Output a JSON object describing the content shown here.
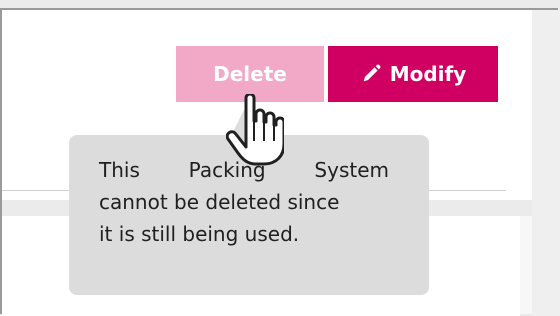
{
  "actions": {
    "delete_label": "Delete",
    "modify_label": "Modify",
    "modify_icon": "pencil-icon",
    "delete_state": "disabled"
  },
  "tooltip": {
    "line1_words": [
      "This",
      "Packing",
      "System"
    ],
    "line2": "cannot be deleted since",
    "line3": "it is still being used."
  },
  "cursor": {
    "icon": "hand-pointer-icon"
  },
  "colors": {
    "primary": "#d00063",
    "disabled": "#f2a9c8",
    "tooltip_background": "#dcdcdc",
    "tooltip_text": "#202020"
  }
}
